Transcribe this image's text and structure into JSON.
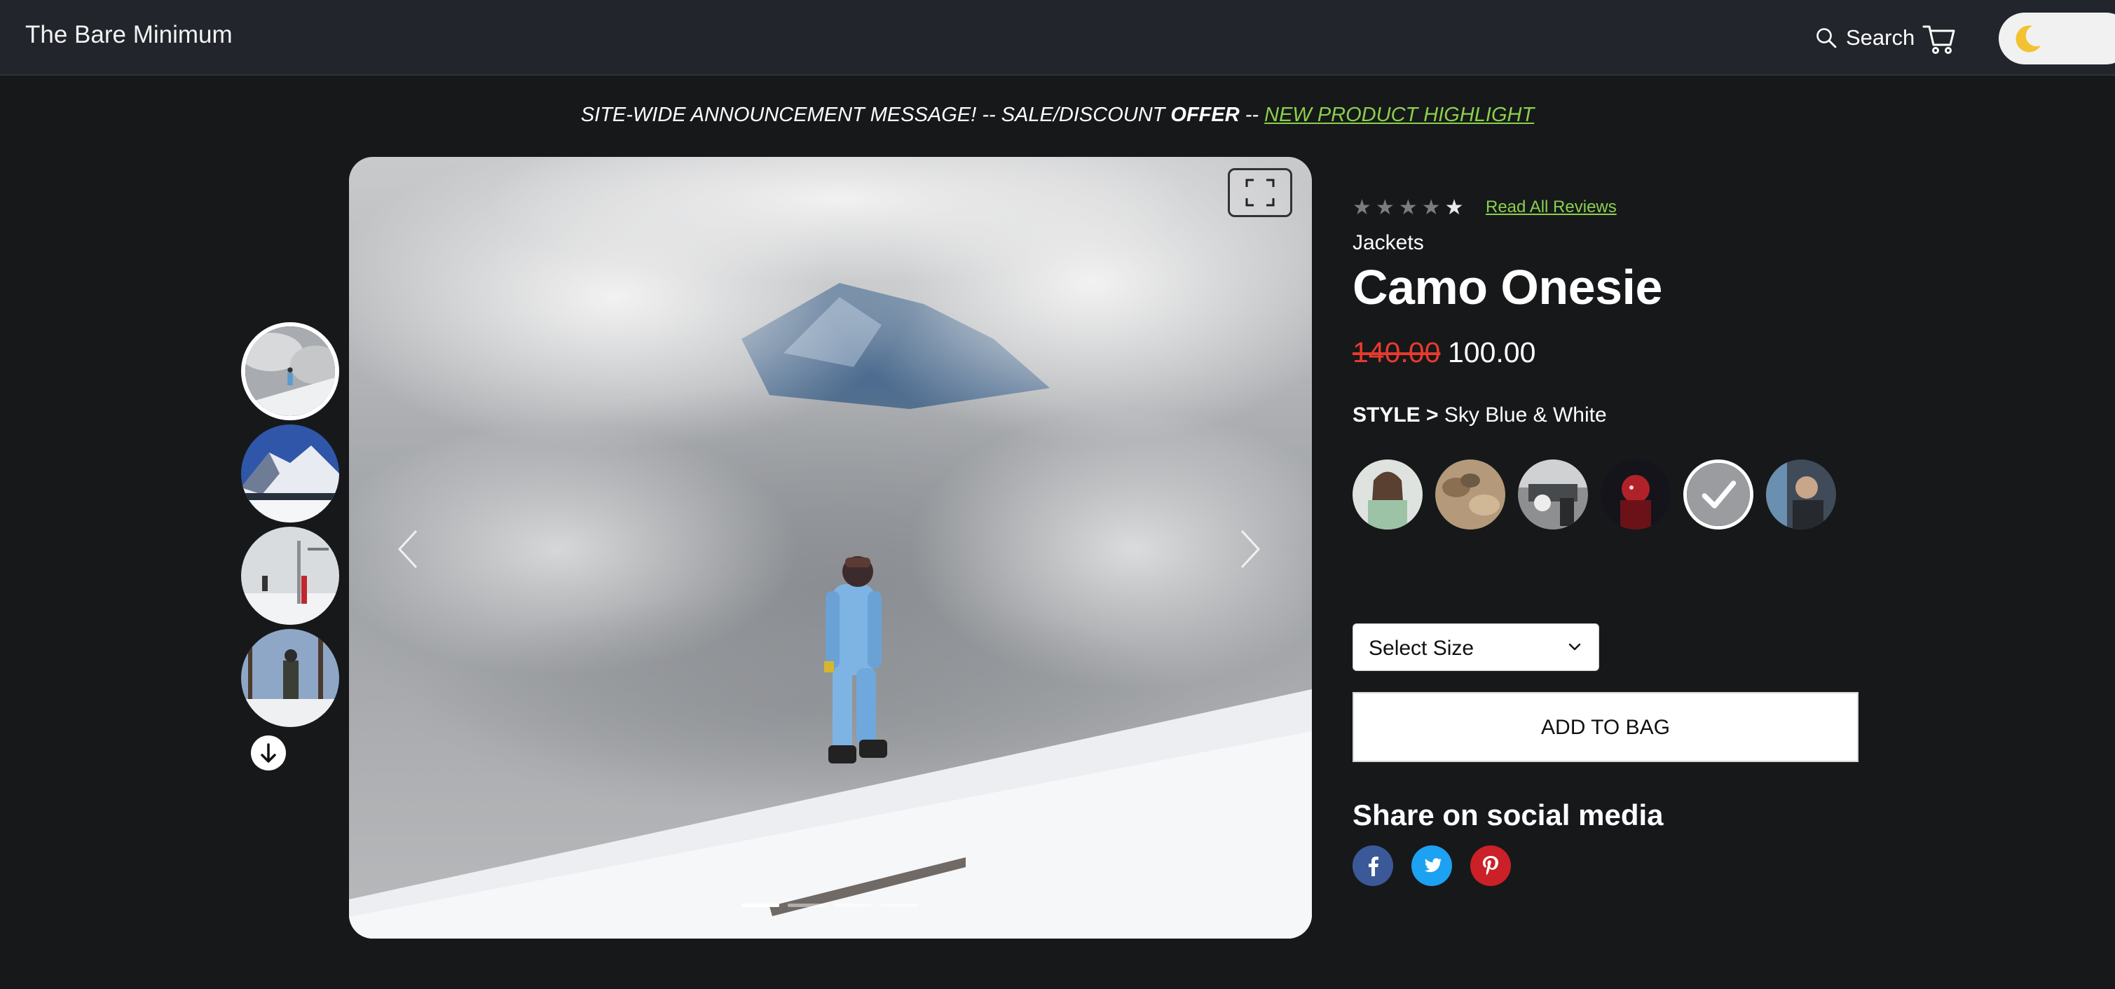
{
  "header": {
    "brand": "The Bare Minimum",
    "search_label": "Search",
    "cart_icon": "cart-icon",
    "theme_toggle_icon": "moon-icon"
  },
  "announcement": {
    "part1": "SITE-WIDE ANNOUNCEMENT MESSAGE! -- SALE/DISCOUNT ",
    "bold": "OFFER",
    "part2": " -- ",
    "link": "NEW PRODUCT HIGHLIGHT"
  },
  "gallery": {
    "thumbnails": [
      "snowboarder",
      "snowy-mountain",
      "ski-lift",
      "hiker-in-woods"
    ],
    "active_thumbnail": 0,
    "slide_count": 4,
    "active_slide": 0
  },
  "product": {
    "rating": {
      "value": 1,
      "max": 5
    },
    "reviews_link": "Read All Reviews",
    "category": "Jackets",
    "title": "Camo Onesie",
    "old_price": "140.00",
    "price": "100.00",
    "style_label": "STYLE >",
    "style_value": "Sky Blue & White",
    "swatches": [
      "model-green",
      "camo-tan",
      "street-bw",
      "red-dark",
      "sky-blue-white",
      "blue-grey"
    ],
    "selected_swatch": 4,
    "size_placeholder": "Select Size",
    "add_to_bag": "ADD TO BAG",
    "share_title": "Share on social media",
    "social": [
      "facebook",
      "twitter",
      "pinterest"
    ]
  },
  "colors": {
    "accent_link": "#8ad04c",
    "sale_price": "#e63a2e",
    "header_bg": "#22252b",
    "page_bg": "#17181a",
    "facebook": "#3b5998",
    "twitter": "#1da1f2",
    "pinterest": "#cb2027"
  }
}
